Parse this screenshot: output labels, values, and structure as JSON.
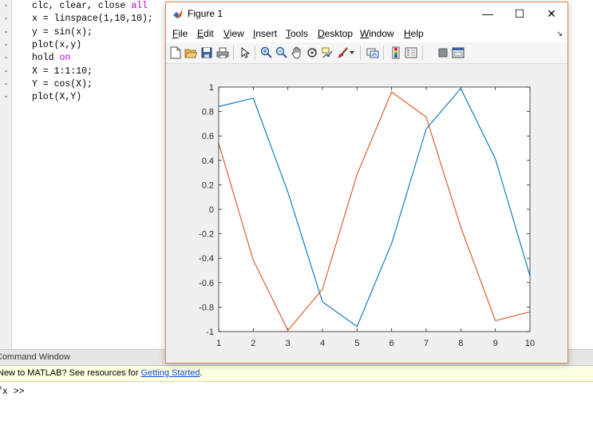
{
  "editor": {
    "lines": [
      [
        {
          "t": "clc, clear, close ",
          "kw": false
        },
        {
          "t": "all",
          "kw": true
        }
      ],
      [
        {
          "t": "x = linspace(1,10,10);",
          "kw": false
        }
      ],
      [
        {
          "t": "y = sin(x);",
          "kw": false
        }
      ],
      [
        {
          "t": "plot(x,y)",
          "kw": false
        }
      ],
      [
        {
          "t": "hold ",
          "kw": false
        },
        {
          "t": "on",
          "kw": true
        }
      ],
      [
        {
          "t": "X = 1:1:10;",
          "kw": false
        }
      ],
      [
        {
          "t": "Y = cos(X);",
          "kw": false
        }
      ],
      [
        {
          "t": "plot(X,Y)",
          "kw": false
        }
      ]
    ],
    "line_marker": "-"
  },
  "command_window": {
    "header": "Command Window",
    "banner_text": "New to MATLAB? See resources for ",
    "banner_link": "Getting Started",
    "banner_end": ".",
    "prompt": "fx >>"
  },
  "figure": {
    "title": "Figure 1",
    "controls": {
      "minimize": "—",
      "maximize": "☐",
      "close": "✕"
    },
    "menu": [
      {
        "label": "File",
        "u": "F",
        "rest": "ile"
      },
      {
        "label": "Edit",
        "u": "E",
        "rest": "dit"
      },
      {
        "label": "View",
        "u": "V",
        "rest": "iew"
      },
      {
        "label": "Insert",
        "u": "I",
        "rest": "nsert"
      },
      {
        "label": "Tools",
        "u": "T",
        "rest": "ools"
      },
      {
        "label": "Desktop",
        "u": "D",
        "rest": "esktop"
      },
      {
        "label": "Window",
        "u": "W",
        "rest": "indow"
      },
      {
        "label": "Help",
        "u": "H",
        "rest": "elp"
      }
    ],
    "dock_glyph": "↘",
    "toolbar_icons": [
      "new-figure-icon",
      "open-file-icon",
      "save-icon",
      "print-icon",
      "pointer-icon",
      "zoom-in-icon",
      "zoom-out-icon",
      "pan-hand-icon",
      "rotate-3d-icon",
      "data-cursor-icon",
      "brush-icon",
      "brush-dropdown-icon",
      "link-plot-icon",
      "colorbar-icon",
      "legend-icon",
      "hide-plot-tools-icon",
      "show-plot-tools-icon"
    ],
    "colors": {
      "series1": "#0072BD",
      "series2": "#D95319"
    }
  },
  "chart_data": {
    "type": "line",
    "title": "",
    "xlabel": "",
    "ylabel": "",
    "xlim": [
      1,
      10
    ],
    "ylim": [
      -1,
      1
    ],
    "xticks": [
      1,
      2,
      3,
      4,
      5,
      6,
      7,
      8,
      9,
      10
    ],
    "yticks": [
      -1,
      -0.8,
      -0.6,
      -0.4,
      -0.2,
      0,
      0.2,
      0.4,
      0.6,
      0.8,
      1
    ],
    "ytick_labels": [
      "-1",
      "-0.8",
      "-0.6",
      "-0.4",
      "-0.2",
      "0",
      "0.2",
      "0.4",
      "0.6",
      "0.8",
      "1"
    ],
    "grid": false,
    "series": [
      {
        "color": "#0072BD",
        "x": [
          1,
          2,
          3,
          4,
          5,
          6,
          7,
          8,
          9,
          10
        ],
        "values": [
          0.841,
          0.909,
          0.141,
          -0.757,
          -0.959,
          -0.279,
          0.657,
          0.989,
          0.412,
          -0.544
        ]
      },
      {
        "color": "#D95319",
        "x": [
          1,
          2,
          3,
          4,
          5,
          6,
          7,
          8,
          9,
          10
        ],
        "values": [
          0.54,
          -0.416,
          -0.99,
          -0.654,
          0.284,
          0.96,
          0.754,
          -0.146,
          -0.911,
          -0.839
        ]
      }
    ]
  }
}
